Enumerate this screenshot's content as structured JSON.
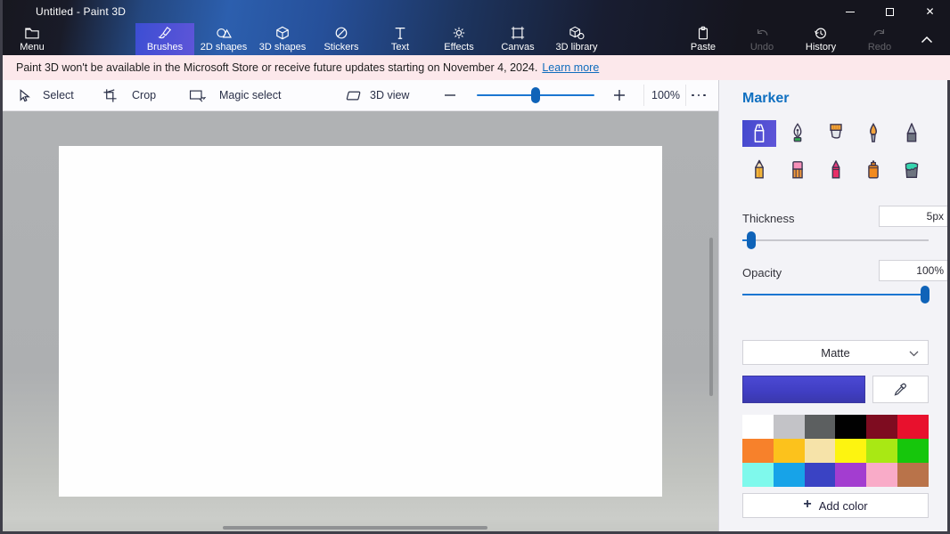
{
  "window": {
    "title": "Untitled - Paint 3D",
    "controls": [
      "minimize",
      "maximize",
      "close"
    ],
    "close_glyph": "✕"
  },
  "ribbon": {
    "menu": {
      "label": "Menu"
    },
    "items": [
      {
        "label": "Brushes",
        "selected": true
      },
      {
        "label": "2D shapes",
        "selected": false
      },
      {
        "label": "3D shapes",
        "selected": false
      },
      {
        "label": "Stickers",
        "selected": false
      },
      {
        "label": "Text",
        "selected": false
      },
      {
        "label": "Effects",
        "selected": false
      },
      {
        "label": "Canvas",
        "selected": false
      },
      {
        "label": "3D library",
        "selected": false
      }
    ],
    "right_items": [
      {
        "label": "Paste",
        "disabled": false
      },
      {
        "label": "Undo",
        "disabled": true
      },
      {
        "label": "History",
        "disabled": false
      },
      {
        "label": "Redo",
        "disabled": true
      }
    ]
  },
  "notification": {
    "message": "Paint 3D won't be available in the Microsoft Store or receive future updates starting on November 4, 2024.",
    "link": "Learn more"
  },
  "toolbar": {
    "select": "Select",
    "crop": "Crop",
    "magic_select": "Magic select",
    "view_3d": "3D view",
    "zoom_percent": 50,
    "zoom_level": "100%"
  },
  "panel": {
    "title": "Marker",
    "brushes": [
      "Marker",
      "Calligraphy pen",
      "Oil brush",
      "Watercolor",
      "Pixel pen",
      "Pencil",
      "Eraser",
      "Crayon",
      "Spray can",
      "Fill"
    ],
    "selected_brush": "Marker",
    "thickness": {
      "label": "Thickness",
      "value": "5px",
      "percent": 5
    },
    "opacity": {
      "label": "Opacity",
      "value": "100%",
      "percent": 100
    },
    "material": {
      "value": "Matte"
    },
    "current_color": "#4342c3",
    "palette": [
      "#ffffff",
      "#c3c3c7",
      "#5c5f60",
      "#010101",
      "#7e0c20",
      "#e8112d",
      "#f7812b",
      "#fcc21c",
      "#f6e3a9",
      "#fdf410",
      "#a9e814",
      "#16c60c",
      "#7ff9ec",
      "#17a3e8",
      "#3a43c4",
      "#a33dd0",
      "#f9abc8",
      "#b9734a"
    ],
    "add_color": "Add color"
  },
  "colors": {
    "accent_blue": "#1b76d1",
    "selected_tile_gradient": [
      "#3c4ed3",
      "#5e55d8"
    ],
    "notification_bg": "#fce8eb",
    "panel_bg": "#f3f3f7",
    "title_blue": "#0f6fc0"
  }
}
